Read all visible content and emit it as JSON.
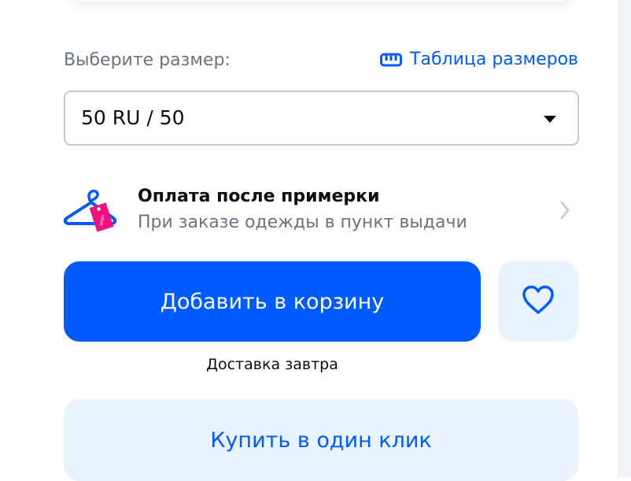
{
  "size": {
    "label": "Выберите размер:",
    "table_link_label": "Таблица размеров",
    "table_icon": "ruler-icon",
    "selected_value": "50 RU / 50"
  },
  "payment": {
    "title": "Оплата после примерки",
    "subtitle": "При заказе одежды в пункт выдачи",
    "icon": "hanger-icon",
    "tag_text": "ozon"
  },
  "actions": {
    "add_to_cart_label": "Добавить в корзину",
    "favorite_icon": "heart-icon",
    "delivery_text": "Доставка завтра",
    "buy_one_click_label": "Купить в один клик"
  },
  "colors": {
    "accent": "#005bff",
    "accent_light": "#e8f3fe",
    "text_primary": "#0b0d10",
    "text_secondary": "#6b7380",
    "tag_pink": "#f1117e"
  }
}
